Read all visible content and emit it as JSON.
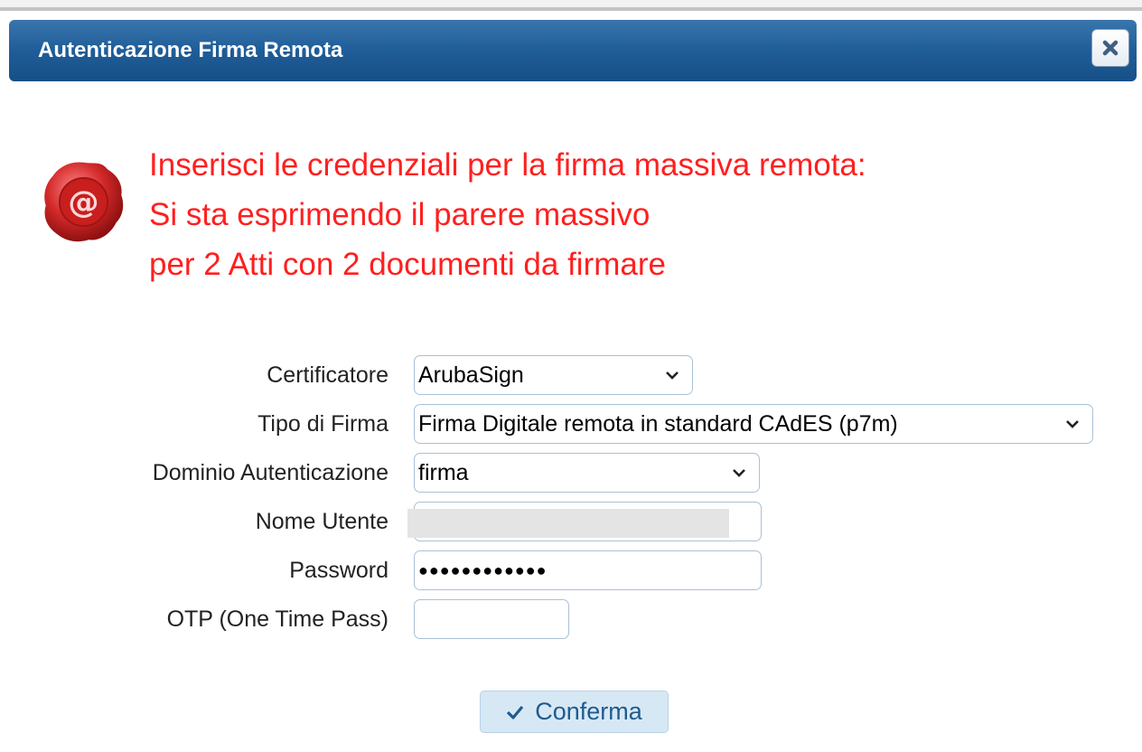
{
  "dialog": {
    "title": "Autenticazione Firma Remota",
    "close_icon": "close-icon"
  },
  "message": {
    "icon": "seal-at-icon",
    "color": "#ff1f1f",
    "lines": [
      "Inserisci le credenziali per la firma massiva remota:",
      "Si sta esprimendo il parere massivo",
      "per 2 Atti con 2 documenti da firmare"
    ]
  },
  "form": {
    "certificatore": {
      "label": "Certificatore",
      "value": "ArubaSign"
    },
    "tipo_firma": {
      "label": "Tipo di Firma",
      "value": "Firma Digitale remota in standard CAdES (p7m)"
    },
    "dominio": {
      "label": "Dominio Autenticazione",
      "value": "firma"
    },
    "nome_utente": {
      "label": "Nome Utente",
      "value": ""
    },
    "password": {
      "label": "Password",
      "value": "●●●●●●●●●●●●"
    },
    "otp": {
      "label": "OTP (One Time Pass)",
      "value": ""
    }
  },
  "actions": {
    "confirm_label": "Conferma",
    "confirm_icon": "checkmark-icon"
  },
  "colors": {
    "titlebar": "#1f5d98",
    "accent_text": "#1f5b8e",
    "button_bg": "#d7e8f5"
  }
}
